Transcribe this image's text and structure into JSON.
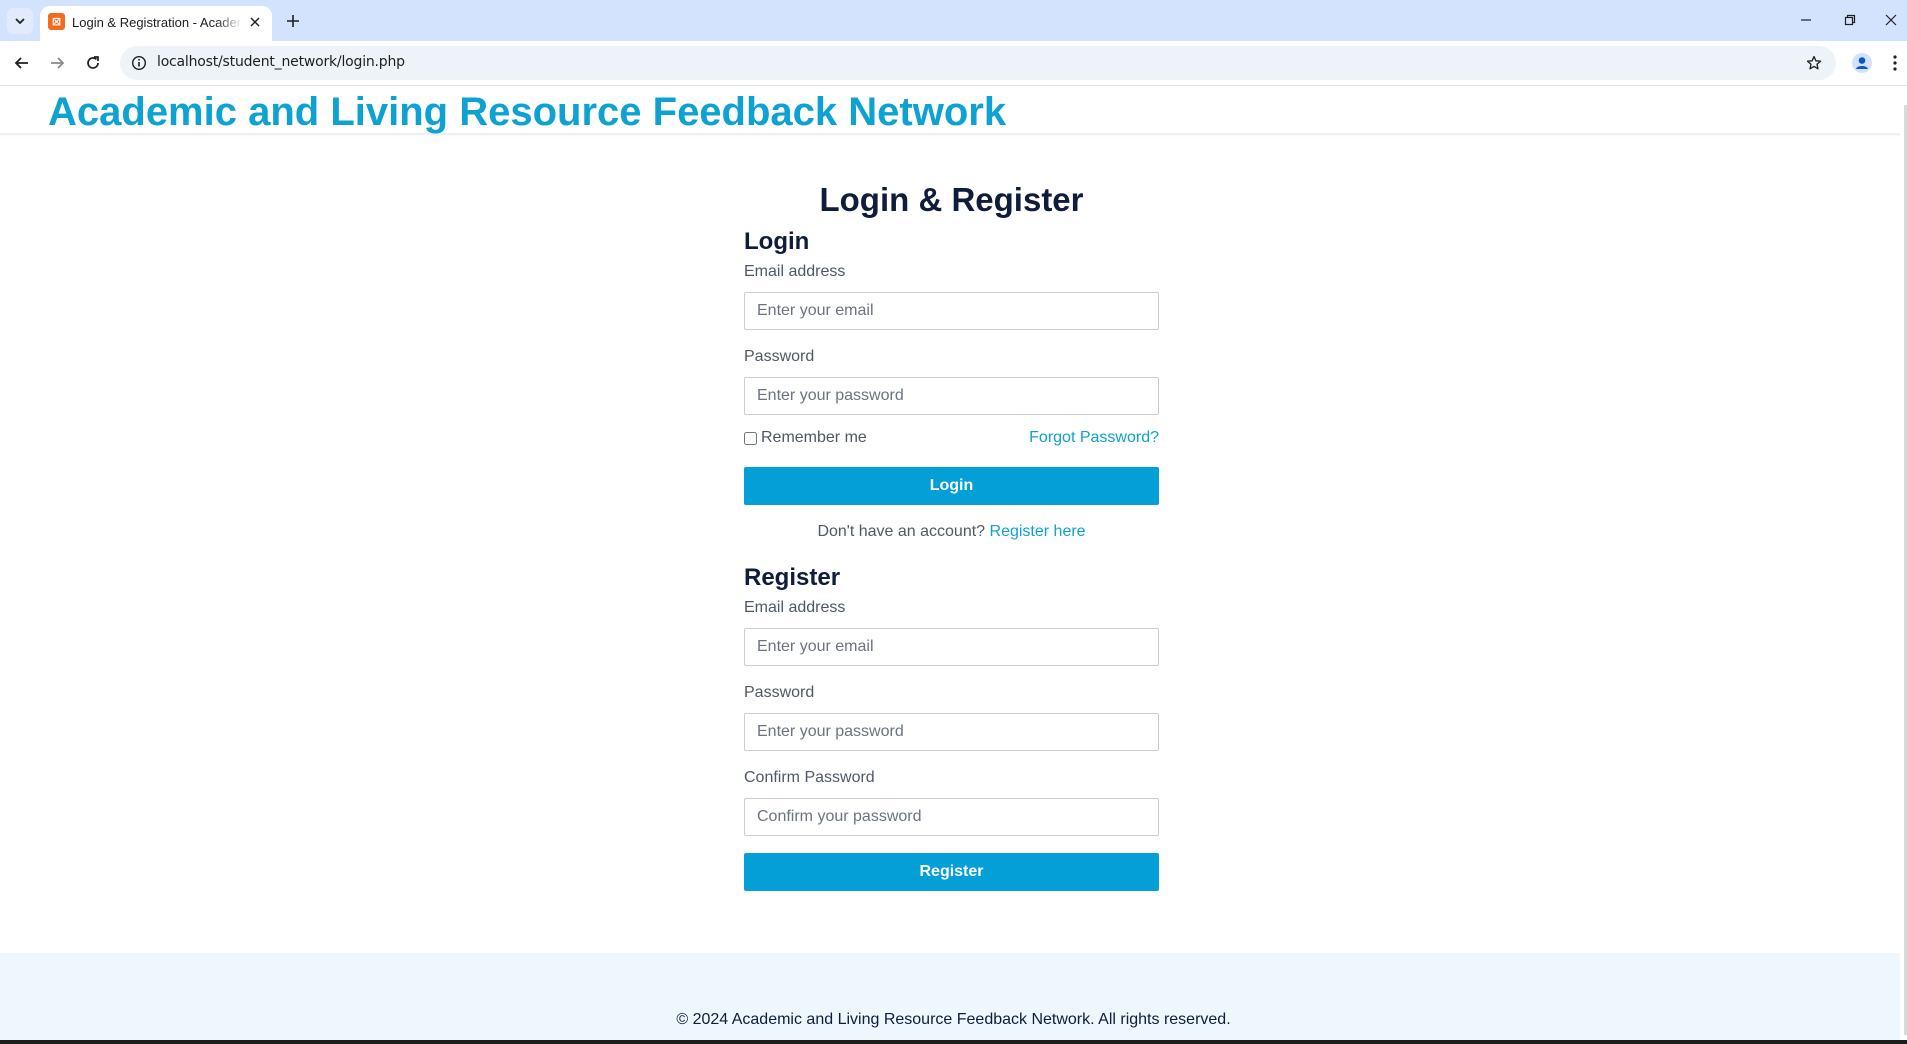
{
  "browser": {
    "tab_title": "Login & Registration - Academic and Living Resource Feedback Network",
    "favicon_glyph": "⌘",
    "url": "localhost/student_network/login.php",
    "icons": {
      "tab_search": "chevron-down-icon",
      "tab_close": "close-icon",
      "new_tab": "plus-icon",
      "back": "arrow-left-icon",
      "forward": "arrow-right-icon",
      "reload": "reload-icon",
      "site_info": "info-icon",
      "bookmark": "star-icon",
      "profile": "person-icon",
      "menu": "more-vertical-icon",
      "minimize": "minimize-icon",
      "restore": "restore-icon",
      "close": "close-icon"
    }
  },
  "header": {
    "site_title": "Academic and Living Resource Feedback Network"
  },
  "main": {
    "heading": "Login & Register",
    "login": {
      "heading": "Login",
      "email_label": "Email address",
      "email_placeholder": "Enter your email",
      "password_label": "Password",
      "password_placeholder": "Enter your password",
      "remember_label": "Remember me",
      "remember_checked": false,
      "forgot_link": "Forgot Password?",
      "submit_label": "Login",
      "no_account_text": "Don't have an account?",
      "register_link": "Register here"
    },
    "register": {
      "heading": "Register",
      "email_label": "Email address",
      "email_placeholder": "Enter your email",
      "password_label": "Password",
      "password_placeholder": "Enter your password",
      "confirm_label": "Confirm Password",
      "confirm_placeholder": "Confirm your password",
      "submit_label": "Register"
    }
  },
  "footer": {
    "text": "© 2024 Academic and Living Resource Feedback Network. All rights reserved."
  },
  "colors": {
    "accent": "#0ea2d2",
    "button": "#039fd6",
    "heading": "#0f1c3a",
    "footer_bg": "#eef7fd",
    "chrome_bg": "#d3e3fd"
  }
}
